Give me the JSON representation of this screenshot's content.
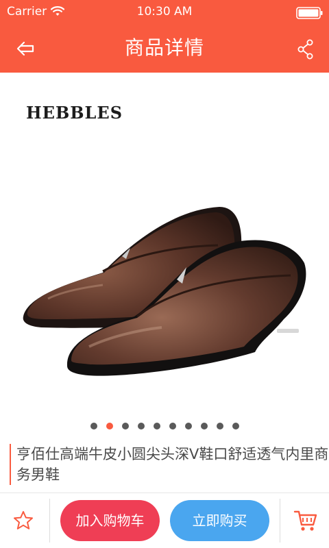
{
  "status_bar": {
    "carrier": "Carrier",
    "time": "10:30 AM",
    "wifi_icon": "wifi-icon",
    "battery_icon": "battery-icon"
  },
  "nav": {
    "title": "商品详情",
    "back_icon": "back-arrow-icon",
    "share_icon": "share-icon"
  },
  "product": {
    "brand": "HEBBLES",
    "image": "brown-leather-shoes-image",
    "title": "亨佰仕高端牛皮小圆尖头深V鞋口舒适透气内里商务男鞋",
    "carousel_total": 10,
    "carousel_active": 2
  },
  "actions": {
    "favorite_icon": "star-outline-icon",
    "add_to_cart": "加入购物车",
    "buy_now": "立即购买",
    "cart_icon": "shopping-cart-icon"
  },
  "colors": {
    "header": "#f95a3f",
    "add_to_cart": "#ef3e55",
    "buy_now": "#4aa6ef",
    "active_dot": "#f95a3f"
  }
}
